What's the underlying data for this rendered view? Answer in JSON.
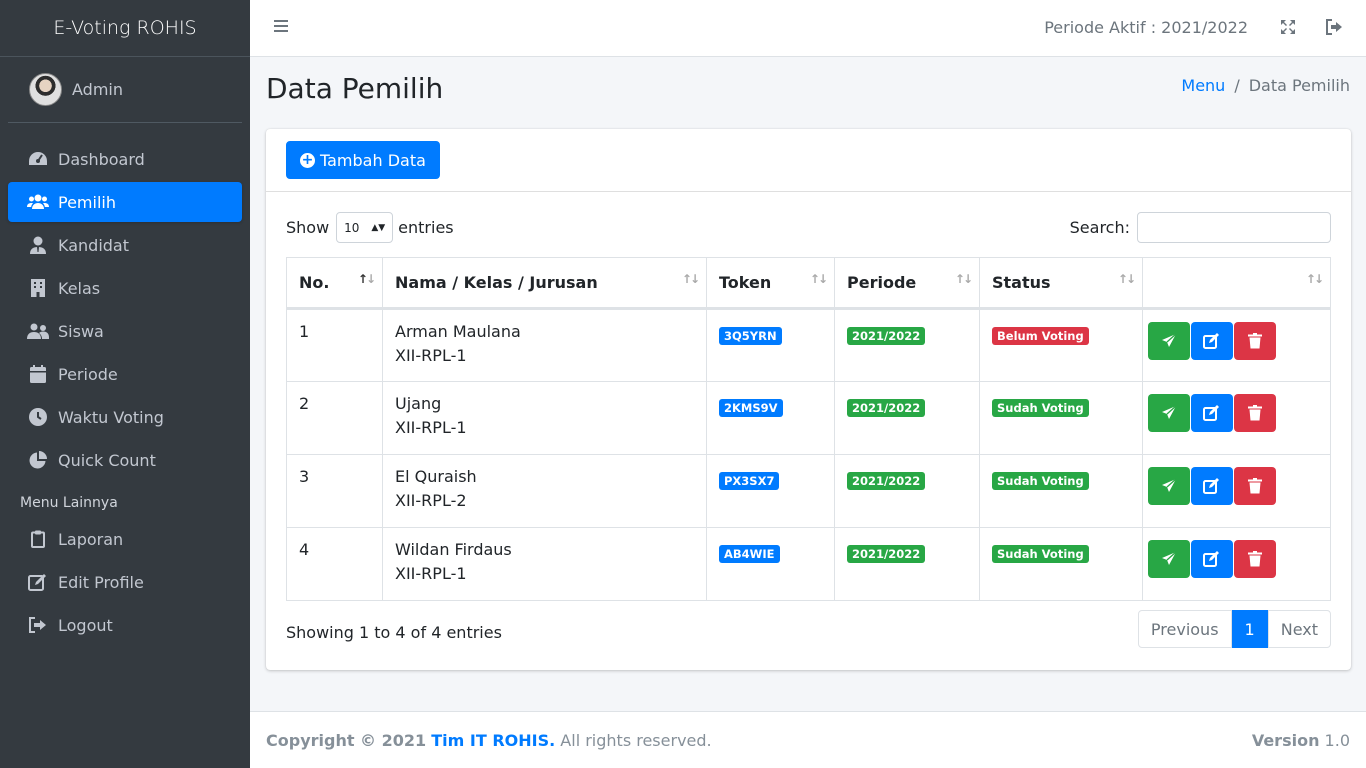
{
  "sidebar": {
    "brand": "E-Voting ROHIS",
    "user": "Admin",
    "items": [
      {
        "label": "Dashboard",
        "icon": "tachometer-icon"
      },
      {
        "label": "Pemilih",
        "icon": "users-icon",
        "active": true
      },
      {
        "label": "Kandidat",
        "icon": "user-tie-icon"
      },
      {
        "label": "Kelas",
        "icon": "building-icon"
      },
      {
        "label": "Siswa",
        "icon": "user-friends-icon"
      },
      {
        "label": "Periode",
        "icon": "calendar-icon"
      },
      {
        "label": "Waktu Voting",
        "icon": "clock-icon"
      },
      {
        "label": "Quick Count",
        "icon": "pie-chart-icon"
      }
    ],
    "header_other": "Menu Lainnya",
    "other_items": [
      {
        "label": "Laporan",
        "icon": "clipboard-icon"
      },
      {
        "label": "Edit Profile",
        "icon": "edit-icon"
      },
      {
        "label": "Logout",
        "icon": "sign-out-icon"
      }
    ]
  },
  "topbar": {
    "periode_text": "Periode Aktif : 2021/2022"
  },
  "content": {
    "title": "Data Pemilih",
    "breadcrumb": [
      "Menu",
      "Data Pemilih"
    ]
  },
  "card": {
    "add_button": "Tambah Data",
    "show_label": "Show",
    "entries_label": "entries",
    "page_length": "10",
    "search_label": "Search:",
    "search_value": ""
  },
  "table": {
    "columns": [
      "No.",
      "Nama / Kelas / Jurusan",
      "Token",
      "Periode",
      "Status",
      ""
    ],
    "rows": [
      {
        "no": "1",
        "name": "Arman Maulana",
        "kelas": "XII-RPL-1",
        "token": "3Q5YRN",
        "periode": "2021/2022",
        "status": "Belum Voting",
        "status_color": "#dc3545"
      },
      {
        "no": "2",
        "name": "Ujang",
        "kelas": "XII-RPL-1",
        "token": "2KMS9V",
        "periode": "2021/2022",
        "status": "Sudah Voting",
        "status_color": "#28a745"
      },
      {
        "no": "3",
        "name": "El Quraish",
        "kelas": "XII-RPL-2",
        "token": "PX3SX7",
        "periode": "2021/2022",
        "status": "Sudah Voting",
        "status_color": "#28a745"
      },
      {
        "no": "4",
        "name": "Wildan Firdaus",
        "kelas": "XII-RPL-1",
        "token": "AB4WIE",
        "periode": "2021/2022",
        "status": "Sudah Voting",
        "status_color": "#28a745"
      }
    ]
  },
  "pagination": {
    "info": "Showing 1 to 4 of 4 entries",
    "previous": "Previous",
    "current": "1",
    "next": "Next"
  },
  "footer": {
    "copyright": "Copyright © 2021",
    "brand": "Tim IT ROHIS.",
    "rights": "All rights reserved.",
    "version_label": "Version",
    "version": "1.0"
  },
  "colors": {
    "primary": "#007bff",
    "success": "#28a745",
    "danger": "#dc3545",
    "sidebar_bg": "#343a40"
  }
}
